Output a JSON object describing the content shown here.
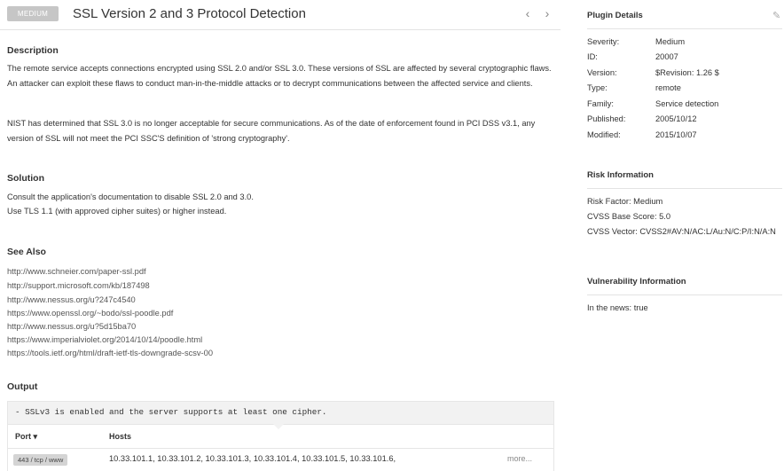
{
  "header": {
    "severity_badge": "MEDIUM",
    "title": "SSL Version 2 and 3 Protocol Detection",
    "prev_icon": "chevron-left-icon",
    "next_icon": "chevron-right-icon"
  },
  "description": {
    "heading": "Description",
    "para1": "The remote service accepts connections encrypted using SSL 2.0 and/or SSL 3.0. These versions of SSL are affected by several cryptographic flaws. An attacker can exploit these flaws to conduct man-in-the-middle attacks or to decrypt communications between the affected service and clients.",
    "para2": "NIST has determined that SSL 3.0 is no longer acceptable for secure communications. As of the date of enforcement found in PCI DSS v3.1, any version of SSL will not meet the PCI SSC'S definition of 'strong cryptography'."
  },
  "solution": {
    "heading": "Solution",
    "line1": "Consult the application's documentation to disable SSL 2.0 and 3.0.",
    "line2": "Use TLS 1.1 (with approved cipher suites) or higher instead."
  },
  "see_also": {
    "heading": "See Also",
    "links": [
      "http://www.schneier.com/paper-ssl.pdf",
      "http://support.microsoft.com/kb/187498",
      "http://www.nessus.org/u?247c4540",
      "https://www.openssl.org/~bodo/ssl-poodle.pdf",
      "http://www.nessus.org/u?5d15ba70",
      "https://www.imperialviolet.org/2014/10/14/poodle.html",
      "https://tools.ietf.org/html/draft-ietf-tls-downgrade-scsv-00"
    ]
  },
  "output": {
    "heading": "Output",
    "text": "- SSLv3 is enabled and the server supports at least one cipher.",
    "col_port": "Port ▾",
    "col_hosts": "Hosts",
    "port": "443 / tcp / www",
    "hosts": "10.33.101.1, 10.33.101.2, 10.33.101.3, 10.33.101.4, 10.33.101.5, 10.33.101.6,",
    "more": "more..."
  },
  "plugin_details": {
    "heading": "Plugin Details",
    "edit_icon": "pencil-icon",
    "rows": [
      {
        "label": "Severity:",
        "value": "Medium"
      },
      {
        "label": "ID:",
        "value": "20007"
      },
      {
        "label": "Version:",
        "value": "$Revision: 1.26 $"
      },
      {
        "label": "Type:",
        "value": "remote"
      },
      {
        "label": "Family:",
        "value": "Service detection"
      },
      {
        "label": "Published:",
        "value": "2005/10/12"
      },
      {
        "label": "Modified:",
        "value": "2015/10/07"
      }
    ]
  },
  "risk": {
    "heading": "Risk Information",
    "factor": "Risk Factor:  Medium",
    "base_score": "CVSS Base Score:  5.0",
    "vector": "CVSS Vector:  CVSS2#AV:N/AC:L/Au:N/C:P/I:N/A:N"
  },
  "vuln": {
    "heading": "Vulnerability Information",
    "news": "In the news:  true"
  },
  "colors": {
    "badge_bg": "#c6c6c6",
    "text": "#333333",
    "link": "#555555",
    "divider": "#e3e3e3",
    "output_bg": "#f2f2f2"
  }
}
